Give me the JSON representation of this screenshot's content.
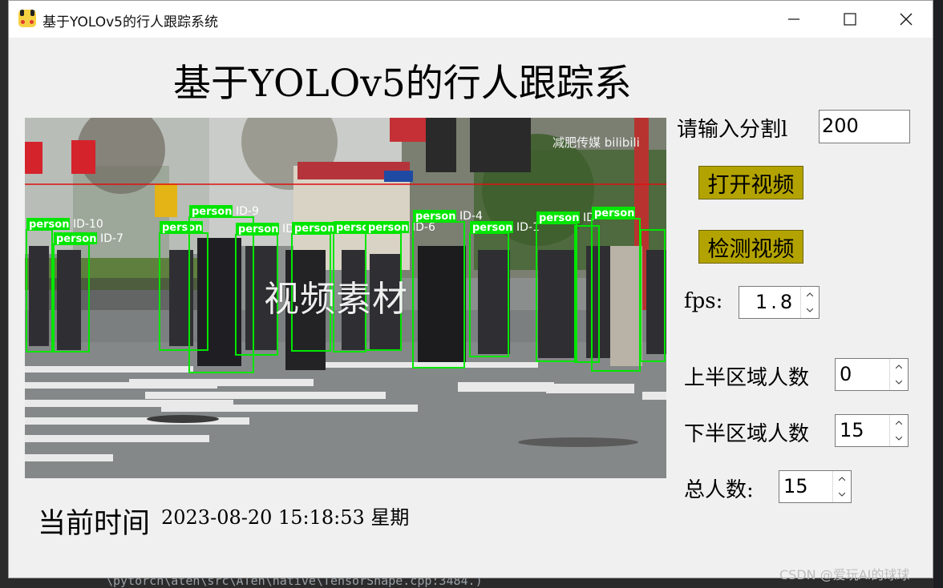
{
  "window": {
    "title": "基于YOLOv5的行人跟踪系统",
    "minimize_icon": "minimize-icon",
    "maximize_icon": "maximize-icon",
    "close_icon": "close-icon"
  },
  "header": {
    "title": "基于YOLOv5的行人跟踪系"
  },
  "video": {
    "watermark": "视频素材",
    "corner_text": "减肥传媒 bilibili",
    "detections": [
      {
        "label": "person",
        "id": "ID-10"
      },
      {
        "label": "person",
        "id": "ID-7"
      },
      {
        "label": "person",
        "id": ""
      },
      {
        "label": "person",
        "id": "ID-9"
      },
      {
        "label": "person",
        "id": "ID-11"
      },
      {
        "label": "person",
        "id": "ID-12"
      },
      {
        "label": "person",
        "id": ""
      },
      {
        "label": "person",
        "id": "ID-6"
      },
      {
        "label": "person",
        "id": "ID-4"
      },
      {
        "label": "person",
        "id": "ID-1"
      },
      {
        "label": "person",
        "id": "ID"
      },
      {
        "label": "person",
        "id": ""
      }
    ]
  },
  "controls": {
    "split_label": "请输入分割l",
    "split_value": "200",
    "open_video_label": "打开视频",
    "detect_video_label": "检测视频",
    "fps_label": "fps:",
    "fps_value": "1.8",
    "upper_count_label": "上半区域人数",
    "upper_count_value": "0",
    "lower_count_label": "下半区域人数",
    "lower_count_value": "15",
    "total_label": "总人数:",
    "total_value": "15"
  },
  "footer": {
    "time_label": "当前时间",
    "time_value": "2023-08-20 15:18:53 星期"
  },
  "background": {
    "code_line": "\\pytorch\\aten\\src\\ATen\\native\\TensorShape.cpp:3484.)",
    "watermark": "CSDN @爱玩AI的球球"
  },
  "colors": {
    "accent_button": "#b3a300",
    "detection_box": "#00e600",
    "split_line": "#e01010"
  }
}
